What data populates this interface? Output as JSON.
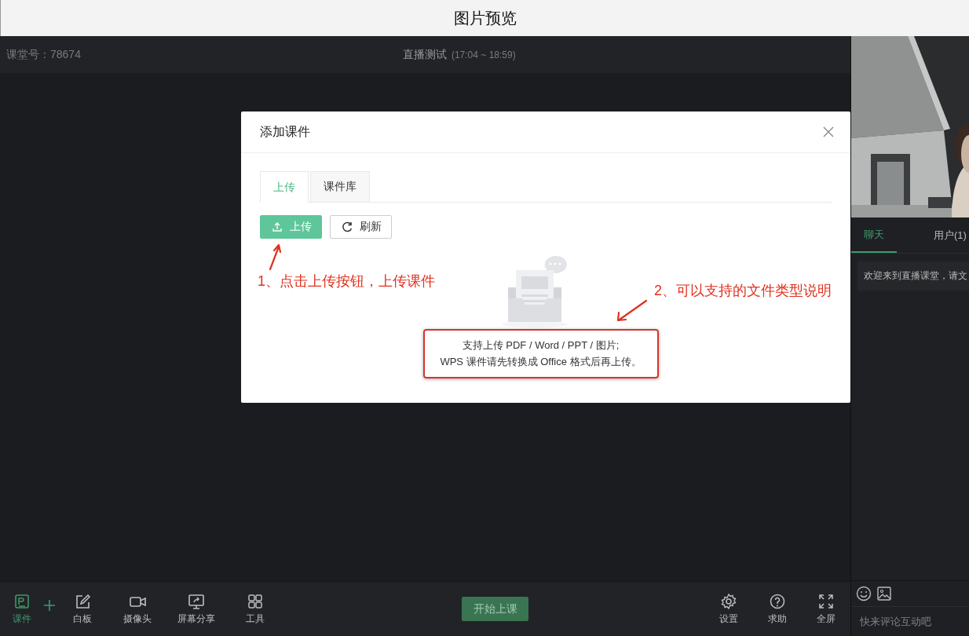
{
  "window": {
    "title": "图片预览"
  },
  "header": {
    "room": "课堂号：78674",
    "course": "直播测试",
    "time": "(17:04 ~ 18:59)"
  },
  "dialog": {
    "title": "添加课件",
    "tabs": [
      {
        "label": "上传",
        "selected": true
      },
      {
        "label": "课件库",
        "selected": false
      }
    ],
    "buttons": [
      {
        "kind": "primary",
        "label": "上传"
      },
      {
        "kind": "default",
        "label": "刷新"
      }
    ],
    "hint": [
      "支持上传 PDF / Word / PPT / 图片;",
      "WPS 课件请先转换成 Office 格式后再上传。"
    ]
  },
  "annotations": [
    {
      "text": "1、点击上传按钮，上传课件"
    },
    {
      "text": "2、可以支持的文件类型说明"
    }
  ],
  "toolbar": {
    "left": [
      {
        "label": "课件",
        "selected": true
      },
      {
        "label": "白板",
        "selected": false
      },
      {
        "label": "摄像头",
        "selected": false
      },
      {
        "label": "屏幕分享",
        "selected": false
      },
      {
        "label": "工具",
        "selected": false
      }
    ],
    "start_button": "开始上课",
    "right": [
      {
        "label": "设置"
      },
      {
        "label": "求助"
      },
      {
        "label": "全屏"
      }
    ]
  },
  "side_panel": {
    "tabs": [
      {
        "label": "聊天",
        "selected": true
      },
      {
        "label": "用户(1)",
        "selected": false
      }
    ],
    "messages": [
      "欢迎来到直播课堂，请文"
    ],
    "input": {
      "placeholder": "快来评论互动吧"
    }
  }
}
